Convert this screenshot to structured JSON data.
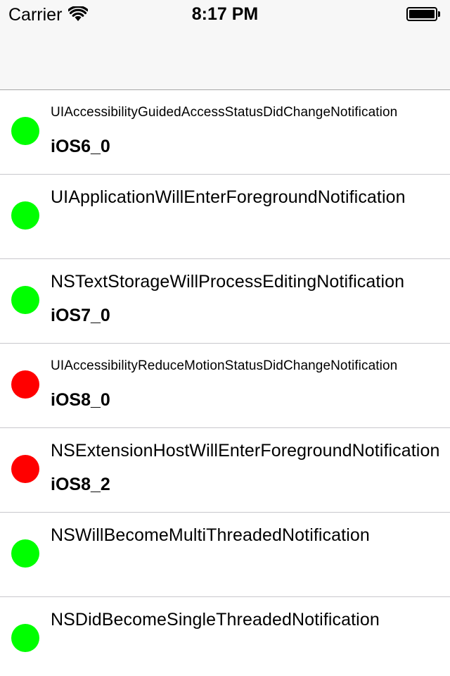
{
  "status_bar": {
    "carrier": "Carrier",
    "time": "8:17 PM",
    "wifi_icon": "wifi-icon",
    "battery_icon": "battery-full-icon"
  },
  "colors": {
    "available": "#00ff00",
    "unavailable": "#ff0000"
  },
  "rows": [
    {
      "name": "UIAccessibilityGuidedAccessStatusDidChangeNotification",
      "version": "iOS6_0",
      "status": "available",
      "small": true
    },
    {
      "name": "UIApplicationWillEnterForegroundNotification",
      "version": "",
      "status": "available",
      "small": false
    },
    {
      "name": "NSTextStorageWillProcessEditingNotification",
      "version": "iOS7_0",
      "status": "available",
      "small": false
    },
    {
      "name": "UIAccessibilityReduceMotionStatusDidChangeNotification",
      "version": "iOS8_0",
      "status": "unavailable",
      "small": true
    },
    {
      "name": "NSExtensionHostWillEnterForegroundNotification",
      "version": "iOS8_2",
      "status": "unavailable",
      "small": false
    },
    {
      "name": "NSWillBecomeMultiThreadedNotification",
      "version": "",
      "status": "available",
      "small": false
    },
    {
      "name": "NSDidBecomeSingleThreadedNotification",
      "version": "",
      "status": "available",
      "small": false
    }
  ]
}
